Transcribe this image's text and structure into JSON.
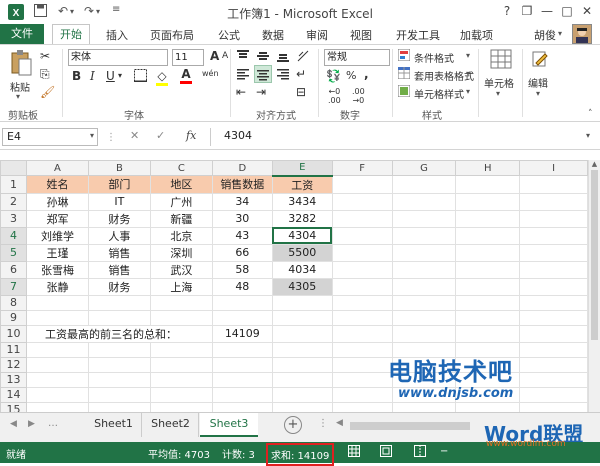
{
  "window": {
    "title": "工作簿1 - Microsoft Excel",
    "help": "?",
    "minimize": "—",
    "restore": "❐",
    "maximize": "□",
    "close": "✕"
  },
  "tabs": [
    "文件",
    "开始",
    "插入",
    "页面布局",
    "公式",
    "数据",
    "审阅",
    "视图",
    "开发工具",
    "加载项"
  ],
  "user": "胡俊",
  "ribbon": {
    "paste": "粘贴",
    "clipboard": "剪贴板",
    "font_name": "宋体",
    "font_size": "11",
    "bold": "B",
    "italic": "I",
    "underline": "U",
    "font_group": "字体",
    "align_group": "对齐方式",
    "number_format": "常规",
    "number_group": "数字",
    "percent": "%",
    "comma": ",",
    "conditional": "条件格式",
    "table_format": "套用表格格式",
    "cell_style": "单元格样式",
    "style_group": "样式",
    "cells": "单元格",
    "editing": "编辑",
    "font_grow": "A",
    "font_shrink": "A",
    "fill_icon": "◇",
    "font_color_icon": "A",
    "wen": "wén"
  },
  "formula_bar": {
    "name_box": "E4",
    "cancel": "✕",
    "enter": "✓",
    "fx": "fx",
    "value": "4304"
  },
  "columns": [
    "A",
    "B",
    "C",
    "D",
    "E",
    "F",
    "G",
    "H",
    "I"
  ],
  "rows": [
    {
      "n": "1",
      "cells": [
        "姓名",
        "部门",
        "地区",
        "销售数据",
        "工资"
      ]
    },
    {
      "n": "2",
      "cells": [
        "孙琳",
        "IT",
        "广州",
        "34",
        "3434"
      ]
    },
    {
      "n": "3",
      "cells": [
        "郑军",
        "财务",
        "新疆",
        "30",
        "3282"
      ]
    },
    {
      "n": "4",
      "cells": [
        "刘维学",
        "人事",
        "北京",
        "43",
        "4304"
      ]
    },
    {
      "n": "5",
      "cells": [
        "王瑾",
        "销售",
        "深圳",
        "66",
        "5500"
      ]
    },
    {
      "n": "6",
      "cells": [
        "张雪梅",
        "销售",
        "武汉",
        "58",
        "4034"
      ]
    },
    {
      "n": "7",
      "cells": [
        "张静",
        "财务",
        "上海",
        "48",
        "4305"
      ]
    },
    {
      "n": "8",
      "cells": [
        "",
        "",
        "",
        "",
        ""
      ]
    },
    {
      "n": "9",
      "cells": [
        "",
        "",
        "",
        "",
        ""
      ]
    },
    {
      "n": "10",
      "cells": [
        "工资最高的前三名的总和：",
        "",
        "",
        "14109",
        ""
      ]
    },
    {
      "n": "11",
      "cells": [
        "",
        "",
        "",
        "",
        ""
      ]
    },
    {
      "n": "12",
      "cells": [
        "",
        "",
        "",
        "",
        ""
      ]
    },
    {
      "n": "13",
      "cells": [
        "",
        "",
        "",
        "",
        ""
      ]
    },
    {
      "n": "14",
      "cells": [
        "",
        "",
        "",
        "",
        ""
      ]
    },
    {
      "n": "15",
      "cells": [
        "",
        "",
        "",
        "",
        ""
      ]
    }
  ],
  "sheets": [
    "Sheet1",
    "Sheet2",
    "Sheet3"
  ],
  "status": {
    "ready": "就绪",
    "average": "平均值: 4703",
    "count": "计数: 3",
    "sum": "求和: 14109",
    "sum_box_color": "#e02020"
  },
  "watermark": {
    "line1": "电脑技术吧",
    "line2": "www.dnjsb.com",
    "line3": "Word联盟",
    "line4": "www.wordlm.com"
  }
}
